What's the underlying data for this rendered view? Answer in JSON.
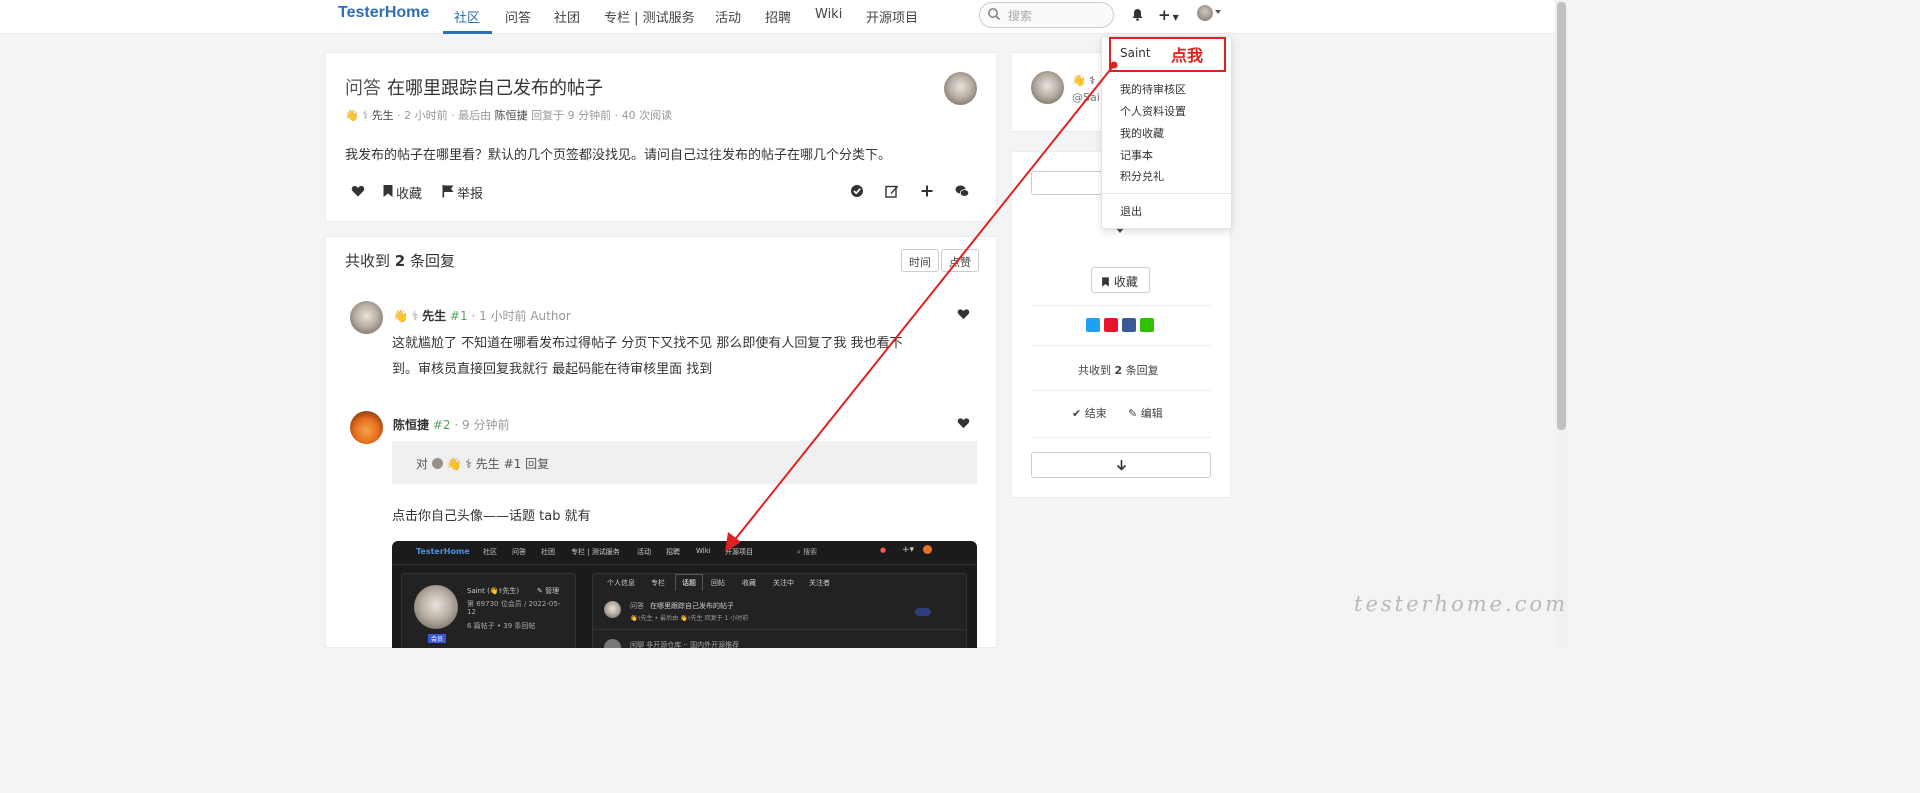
{
  "nav": {
    "brand": "TesterHome",
    "items": [
      "社区",
      "问答",
      "社团",
      "专栏 | 测试服务",
      "活动",
      "招聘",
      "Wiki",
      "开源项目"
    ],
    "search_placeholder": "搜索",
    "plus_label": "+"
  },
  "topic": {
    "node": "问答",
    "title": "在哪里跟踪自己发布的帖子",
    "meta_emoji": "👋 ⚕",
    "author": "先生",
    "meta_time": "· 2 小时前 · 最后由",
    "last_replier": "陈恒捷",
    "meta_tail": "回复于 9 分钟前 · 40 次阅读",
    "body": "我发布的帖子在哪里看？默认的几个页签都没找见。请问自己过往发布的帖子在哪几个分类下。",
    "actions": {
      "favorite": "收藏",
      "report": "举报"
    }
  },
  "replies": {
    "header_prefix": "共收到",
    "count": "2",
    "header_suffix": "条回复",
    "sort_time": "时间",
    "sort_votes": "点赞",
    "list": [
      {
        "emoji": "👋 ⚕",
        "name": "先生",
        "floor": "#1",
        "time": "· 1 小时前 Author",
        "text_line1": "这就尴尬了 不知道在哪看发布过得帖子 分页下又找不见 那么即使有人回复了我 我也看不",
        "text_line2": "到。审核员直接回复我就行 最起码能在待审核里面 找到"
      },
      {
        "name": "陈恒捷",
        "floor": "#2",
        "time": "· 9 分钟前",
        "quote_prefix": "对",
        "quote_name": "👋 ⚕ 先生",
        "quote_floor": "#1 回复",
        "text": "点击你自己头像——话题 tab 就有"
      }
    ]
  },
  "embed": {
    "brand": "TesterHome",
    "nav": [
      "社区",
      "问答",
      "社团",
      "专栏 | 测试服务",
      "活动",
      "招聘",
      "Wiki",
      "开源项目"
    ],
    "search": "搜索",
    "tabs": [
      "个人信息",
      "专栏",
      "话题",
      "回帖",
      "收藏",
      "关注中",
      "关注者"
    ],
    "profile_name": "Saint (👋⚕先生)",
    "manage": "管理",
    "member_line": "第 69730 位会员 / 2022-05-",
    "member_line2": "12",
    "stats": "6 篇帖子 • 39 条回帖",
    "badge": "会员",
    "topic1_node": "问答",
    "topic1_title": "在哪里跟踪自己发布的帖子",
    "topic1_meta": "👋⚕先生 • 最后由 👋⚕先生 回复于 1 小时前",
    "topic2": "闲聊 非开源仓库 ·· 国内外开源推荐"
  },
  "sidebar": {
    "emoji": "👋 ⚕",
    "handle": "@Sai",
    "favorite": "收藏",
    "count_prefix": "共收到",
    "count": "2",
    "count_suffix": "条回复",
    "close": "结束",
    "edit": "编辑"
  },
  "dropdown": {
    "username": "Saint",
    "items": [
      "我的待审核区",
      "个人资料设置",
      "我的收藏",
      "记事本",
      "积分兑礼"
    ],
    "logout": "退出"
  },
  "annotation": {
    "label": "点我",
    "color": "#e02020"
  },
  "watermark": "testerhome.com",
  "colors": {
    "brand": "#2f6fb5",
    "floor": "#5aa05a"
  }
}
